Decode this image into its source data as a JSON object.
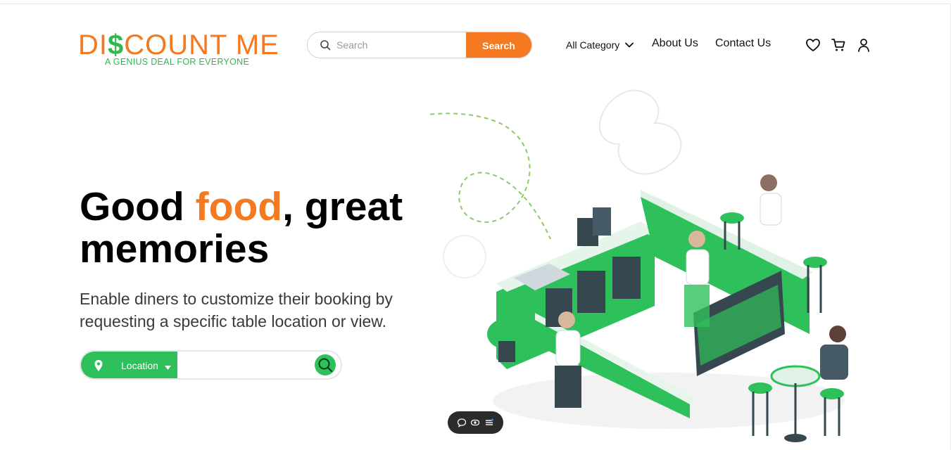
{
  "brand": {
    "name_part1": "DI",
    "name_dollar": "$",
    "name_part2": "COUNT ME",
    "tagline": "A GENIUS DEAL FOR EVERYONE",
    "accent_color": "#f47920",
    "green_color": "#2fb84e"
  },
  "header": {
    "search": {
      "placeholder": "Search",
      "button_label": "Search",
      "icon": "search-icon"
    },
    "nav": {
      "category_label": "All Category",
      "about_label": "About Us",
      "contact_label": "Contact Us"
    },
    "icons": [
      "heart-icon",
      "cart-icon",
      "user-icon"
    ]
  },
  "hero": {
    "title_part1": "Good ",
    "title_accent": "food",
    "title_part2": ", great memories",
    "subtitle": "Enable diners to customize their booking by requesting a specific table location or view.",
    "location": {
      "label": "Location",
      "icon": "location-pin-icon",
      "go_icon": "search-icon"
    }
  },
  "floating_toolbar": {
    "icons": [
      "comment-icon",
      "eye-icon",
      "list-icon"
    ]
  }
}
